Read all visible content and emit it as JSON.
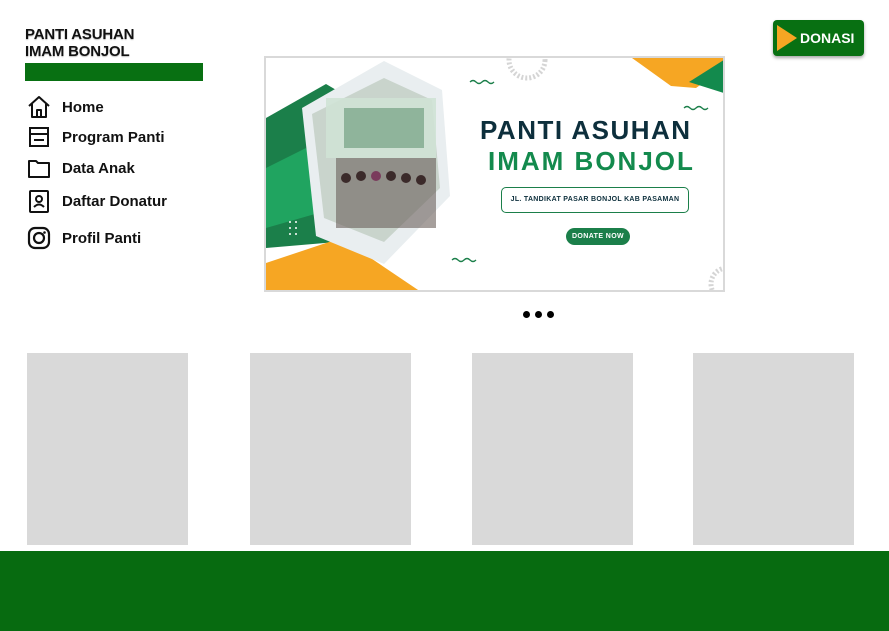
{
  "brand": {
    "line1": "PANTI ASUHAN",
    "line2": "IMAM BONJOL"
  },
  "nav": {
    "items": [
      {
        "label": "Home",
        "icon": "home-icon"
      },
      {
        "label": "Program Panti",
        "icon": "browser-window-icon"
      },
      {
        "label": "Data Anak",
        "icon": "folder-icon"
      },
      {
        "label": "Daftar Donatur",
        "icon": "contact-card-icon"
      },
      {
        "label": "Profil Panti",
        "icon": "instagram-icon"
      }
    ]
  },
  "donasi_button": {
    "label": "DONASI",
    "icon": "play-icon"
  },
  "banner": {
    "title_line1": "PANTI ASUHAN",
    "title_line2": "IMAM BONJOL",
    "address": "JL. TANDIKAT PASAR BONJOL KAB PASAMAN",
    "donate_label": "DONATE NOW"
  },
  "carousel": {
    "dot_count": 3
  },
  "cards": {
    "count": 4
  },
  "colors": {
    "brand_green": "#087012",
    "accent_orange": "#f6a623",
    "banner_green": "#138a4d",
    "banner_navy": "#0d2f3c",
    "placeholder_gray": "#d9d9d9"
  }
}
